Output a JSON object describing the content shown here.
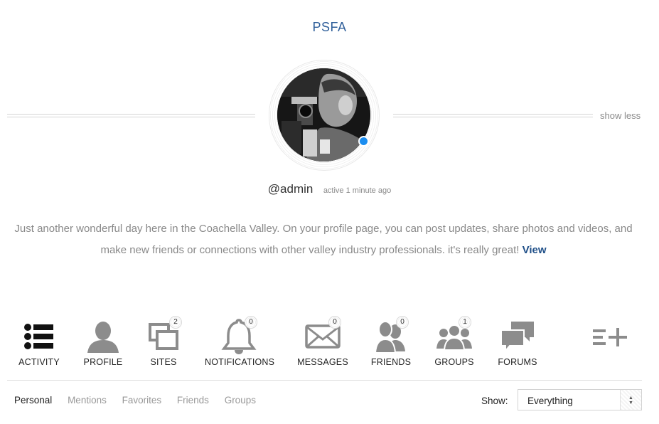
{
  "site": {
    "title": "PSFA"
  },
  "header": {
    "show_less": "show less"
  },
  "profile": {
    "handle": "@admin",
    "active": "active 1 minute ago",
    "status_color": "#1a8df0",
    "bio": "Just another wonderful day here in the Coachella Valley. On your profile page, you can post updates, share photos and videos, and make new friends or connections with other valley industry professionals. it's really great!",
    "bio_link": "View"
  },
  "nav": {
    "items": [
      {
        "label": "ACTIVITY",
        "icon": "list-icon"
      },
      {
        "label": "PROFILE",
        "icon": "person-icon"
      },
      {
        "label": "SITES",
        "icon": "sites-icon",
        "count": "2"
      },
      {
        "label": "NOTIFICATIONS",
        "icon": "bell-icon",
        "count": "0"
      },
      {
        "label": "MESSAGES",
        "icon": "envelope-icon",
        "count": "0"
      },
      {
        "label": "FRIENDS",
        "icon": "friends-icon",
        "count": "0"
      },
      {
        "label": "GROUPS",
        "icon": "groups-icon",
        "count": "1"
      },
      {
        "label": "FORUMS",
        "icon": "chat-bubbles-icon"
      }
    ],
    "more_icon": "list-add-icon"
  },
  "subnav": {
    "tabs": [
      "Personal",
      "Mentions",
      "Favorites",
      "Friends",
      "Groups"
    ],
    "active": "Personal"
  },
  "filter": {
    "label": "Show:",
    "selected": "Everything"
  },
  "colors": {
    "accent": "#2f5f9a",
    "icon": "#8c8c8c",
    "link": "#1f4f88"
  }
}
